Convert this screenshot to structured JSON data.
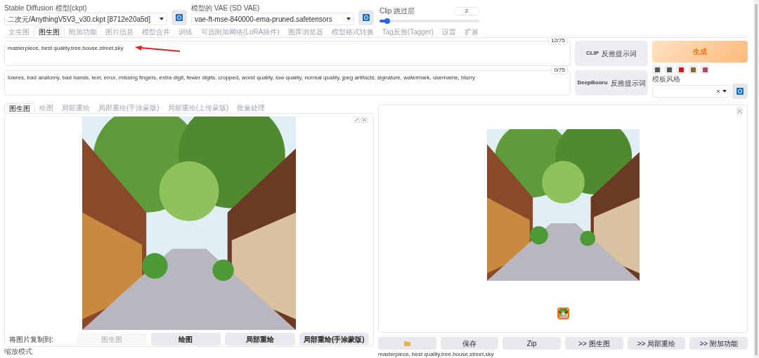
{
  "model_selects": [
    {
      "label": "Stable Diffusion 模型(ckpt)",
      "value": "二次元/AnythingV5V3_v30.ckpt [8712e20a5d]"
    },
    {
      "label": "模型的 VAE (SD VAE)",
      "value": "vae-ft-mse-840000-ema-pruned.safetensors"
    }
  ],
  "clip_skip": {
    "label": "Clip 跳过层",
    "value": "2",
    "level": 0.08
  },
  "tabs": [
    {
      "label": "文生图",
      "selected": false
    },
    {
      "label": "图生图",
      "selected": true
    },
    {
      "label": "附加功能",
      "selected": false
    },
    {
      "label": "图片信息",
      "selected": false
    },
    {
      "label": "模型合并",
      "selected": false
    },
    {
      "label": "训练",
      "selected": false
    },
    {
      "label": "可选附加网络(LoRA插件)",
      "selected": false
    },
    {
      "label": "图库浏览器",
      "selected": false
    },
    {
      "label": "模型格式转换",
      "selected": false
    },
    {
      "label": "Tag反推(Tagger)",
      "selected": false
    },
    {
      "label": "设置",
      "selected": false
    },
    {
      "label": "扩展",
      "selected": false
    }
  ],
  "prompt": {
    "value": "masterpiece, best quality,tree,house,street,sky",
    "counter": "12/75"
  },
  "negative_prompt": {
    "value": "lowres, bad anatomy, bad hands, text, error, missing fingers, extra digit, fewer digits, cropped, worst quality, low quality, normal quality, jpeg artifacts, signature, watermark, username, blurry",
    "counter": "0/75"
  },
  "interrogate_buttons": [
    {
      "prefix": "CLIP",
      "label": "反推提示词"
    },
    {
      "prefix": "DeepBooru",
      "label": "反推提示词"
    }
  ],
  "generate_button": "生成",
  "styles": {
    "label": "模板风格"
  },
  "image_tabs": [
    {
      "label": "图生图",
      "selected": true
    },
    {
      "label": "绘图",
      "selected": false
    },
    {
      "label": "局部重绘",
      "selected": false
    },
    {
      "label": "局部重绘(手涂蒙版)",
      "selected": false
    },
    {
      "label": "局部重绘(上传蒙版)",
      "selected": false
    },
    {
      "label": "批量处理",
      "selected": false
    }
  ],
  "copy_to": {
    "label": "将图片复制到:",
    "buttons": [
      {
        "label": "图生图",
        "disabled": true
      },
      {
        "label": "绘图",
        "disabled": false
      },
      {
        "label": "局部重绘",
        "disabled": false
      },
      {
        "label": "局部重绘(手涂蒙版)",
        "disabled": false
      }
    ]
  },
  "resize_mode": {
    "label": "缩放模式"
  },
  "output_buttons": [
    {
      "kind": "folder"
    },
    {
      "kind": "text",
      "label": "保存"
    },
    {
      "kind": "text",
      "label": "Zip"
    },
    {
      "kind": "text",
      "label": ">> 图生图"
    },
    {
      "kind": "text",
      "label": ">> 局部重绘"
    },
    {
      "kind": "text",
      "label": ">> 附加功能"
    }
  ],
  "output_caption": "masterpiece, best quality,tree,house,street,sky"
}
